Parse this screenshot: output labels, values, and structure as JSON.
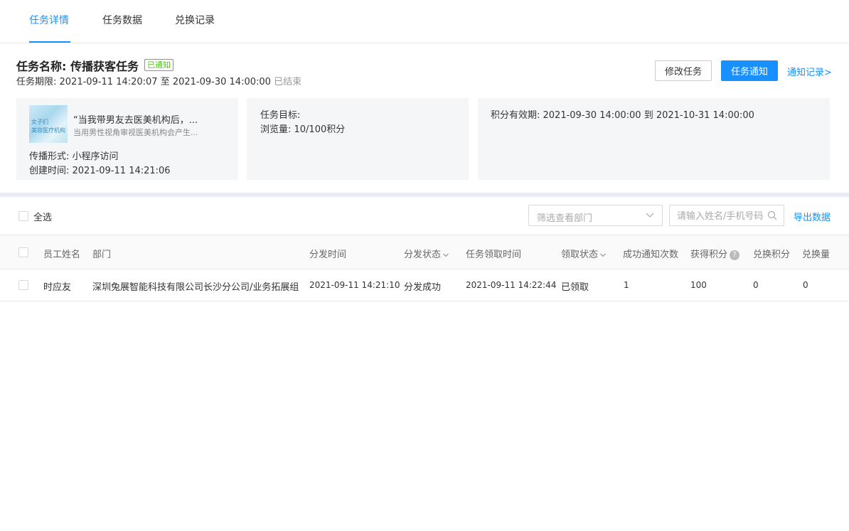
{
  "tabs": [
    {
      "label": "任务详情",
      "active": true
    },
    {
      "label": "任务数据",
      "active": false
    },
    {
      "label": "兑换记录",
      "active": false
    }
  ],
  "header": {
    "title": "任务名称: 传播获客任务",
    "badge": "已通知",
    "period_label": "任务期限: 2021-09-11 14:20:07 至 2021-09-30 14:00:00",
    "status": "已结束",
    "modify_button": "修改任务",
    "notify_button": "任务通知",
    "records_link": "通知记录>"
  },
  "cards": {
    "content": {
      "title": "“当我带男友去医美机构后，...",
      "subtitle": "当用男性视角审视医美机构会产生...",
      "thumb_text_1": "女子们",
      "thumb_text_2": "美容医疗机构",
      "spread_form": "传播形式: 小程序访问",
      "created_at": "创建时间: 2021-09-11 14:21:06"
    },
    "target": {
      "label": "任务目标:",
      "value": "浏览量: 10/100积分"
    },
    "points": {
      "validity": "积分有效期: 2021-09-30 14:00:00 到 2021-10-31 14:00:00"
    }
  },
  "toolbar": {
    "select_all": "全选",
    "dept_placeholder": "筛选查看部门",
    "search_placeholder": "请输入姓名/手机号码",
    "export": "导出数据"
  },
  "table": {
    "headers": {
      "name": "员工姓名",
      "dept": "部门",
      "dispatch_time": "分发时间",
      "dispatch_status": "分发状态",
      "claim_time": "任务领取时间",
      "claim_status": "领取状态",
      "notify_count": "成功通知次数",
      "points_earned": "获得积分",
      "points_redeemed": "兑换积分",
      "redeem_qty": "兑换量"
    },
    "rows": [
      {
        "name": "时应友",
        "dept": "深圳兔展智能科技有限公司长沙分公司/业务拓展组",
        "dispatch_time": "2021-09-11 14:21:10",
        "dispatch_status": "分发成功",
        "claim_time": "2021-09-11 14:22:44",
        "claim_status": "已领取",
        "notify_count": "1",
        "points_earned": "100",
        "points_redeemed": "0",
        "redeem_qty": "0"
      }
    ]
  },
  "colors": {
    "accent": "#1890ff",
    "badge": "#52c41a",
    "card_bg": "#f5f6f8"
  }
}
